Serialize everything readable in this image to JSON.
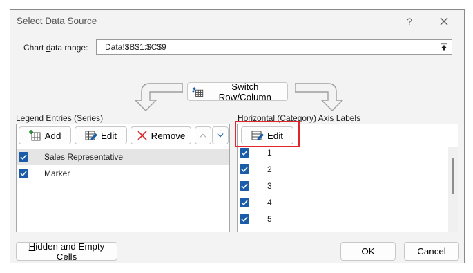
{
  "dialog": {
    "title": "Select Data Source",
    "help_label": "?",
    "chart_data_range": {
      "label_before": "Chart ",
      "label_accel": "d",
      "label_after": "ata range:",
      "value": "=Data!$B$1:$C$9"
    },
    "switch_button": {
      "accel": "S",
      "rest": "witch Row/Column"
    },
    "legend_section": {
      "label_before": "Legend Entries (",
      "label_accel": "S",
      "label_after": "eries)",
      "add": {
        "accel": "A",
        "rest": "dd"
      },
      "edit": {
        "accel": "E",
        "rest": "dit"
      },
      "remove": {
        "accel": "R",
        "rest": "emove"
      },
      "series": [
        {
          "label": "Sales Representative",
          "checked": true,
          "selected": true
        },
        {
          "label": "Marker",
          "checked": true,
          "selected": false
        }
      ]
    },
    "axis_section": {
      "label_before": "Horizontal (",
      "label_accel": "C",
      "label_after": "ategory) Axis Labels",
      "edit": {
        "before": "Ed",
        "accel": "i",
        "after": "t"
      },
      "items": [
        "1",
        "2",
        "3",
        "4",
        "5"
      ]
    },
    "hidden_button": {
      "accel": "H",
      "rest": "idden and Empty Cells"
    },
    "ok_label": "OK",
    "cancel_label": "Cancel",
    "colors": {
      "checkbox": "#1a5ca8",
      "highlight": "#e0262b",
      "arrow": "#9e9e9e"
    }
  }
}
